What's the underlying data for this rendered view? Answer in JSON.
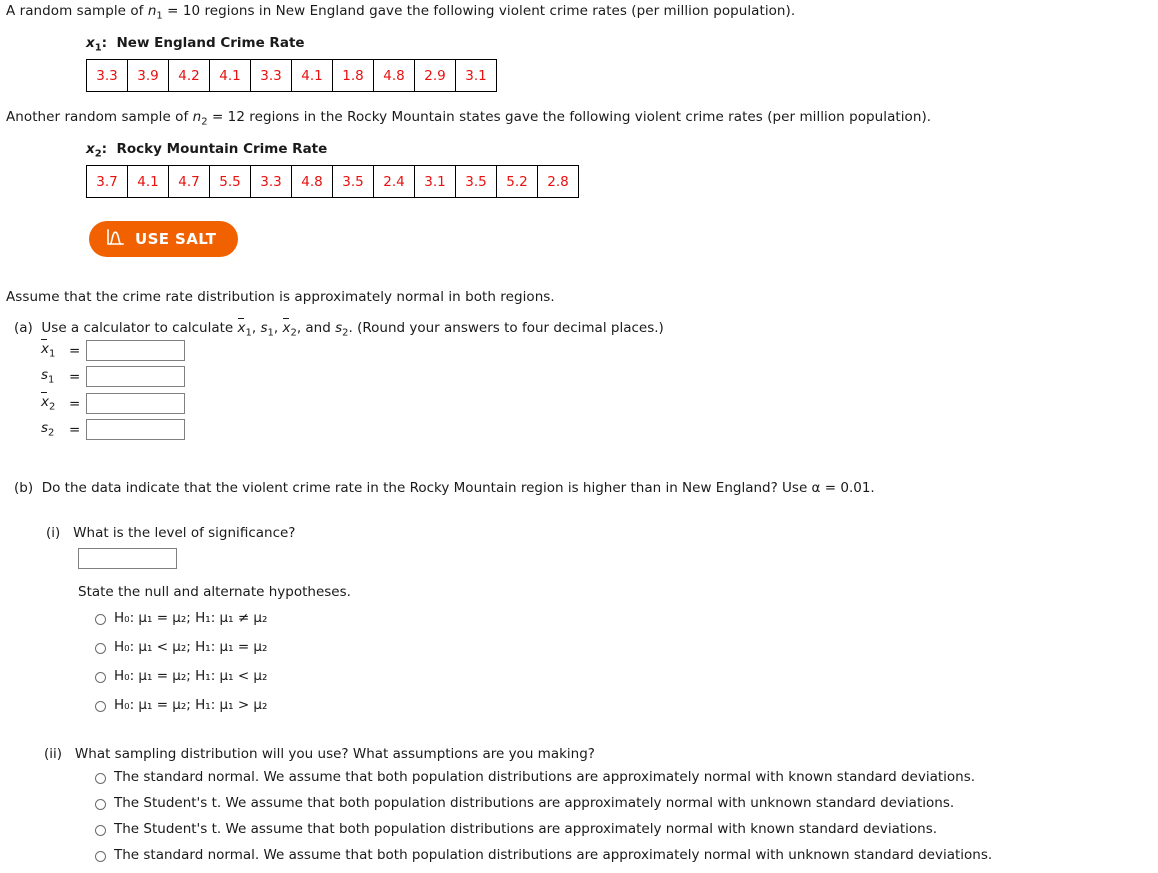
{
  "intro": {
    "line1_pre": "A random sample of ",
    "line1_var": "n",
    "line1_sub": "1",
    "line1_post": " = 10 regions in New England gave the following violent crime rates (per million population).",
    "line2_pre": "Another random sample of ",
    "line2_var": "n",
    "line2_sub": "2",
    "line2_post": " = 12 regions in the Rocky Mountain states gave the following violent crime rates (per million population).",
    "assume": "Assume that the crime rate distribution is approximately normal in both regions."
  },
  "samples": [
    {
      "var_symbol": "x",
      "var_sub": "1",
      "title": "New England Crime Rate",
      "values": [
        "3.3",
        "3.9",
        "4.2",
        "4.1",
        "3.3",
        "4.1",
        "1.8",
        "4.8",
        "2.9",
        "3.1"
      ]
    },
    {
      "var_symbol": "x",
      "var_sub": "2",
      "title": "Rocky Mountain Crime Rate",
      "values": [
        "3.7",
        "4.1",
        "4.7",
        "5.5",
        "3.3",
        "4.8",
        "3.5",
        "2.4",
        "3.1",
        "3.5",
        "5.2",
        "2.8"
      ]
    }
  ],
  "salt_button": {
    "label": "USE SALT",
    "icon": "distribution-curve-icon",
    "background_color": "#f26100",
    "text_color": "#ffffff"
  },
  "part_a": {
    "marker": "(a)",
    "prompt_pre": "Use a calculator to calculate ",
    "prompt_post": ". (Round your answers to four decimal places.)",
    "symbols": [
      "x̄₁",
      "s₁",
      "x̄₂",
      "s₂"
    ],
    "fields": [
      {
        "symbol_base": "x",
        "symbol_sub": "1",
        "overline": true,
        "value": "",
        "placeholder": ""
      },
      {
        "symbol_base": "s",
        "symbol_sub": "1",
        "overline": false,
        "value": "",
        "placeholder": ""
      },
      {
        "symbol_base": "x",
        "symbol_sub": "2",
        "overline": true,
        "value": "",
        "placeholder": ""
      },
      {
        "symbol_base": "s",
        "symbol_sub": "2",
        "overline": false,
        "value": "",
        "placeholder": ""
      }
    ],
    "equals": "="
  },
  "part_b": {
    "marker": "(b)",
    "question": "Do the data indicate that the violent crime rate in the Rocky Mountain region is higher than in New England? Use α = 0.01.",
    "alpha_value": "0.01",
    "sub_i": {
      "marker": "(i)",
      "question": "What is the level of significance?",
      "input_value": "",
      "input_placeholder": "",
      "hypotheses_prompt": "State the null and alternate hypotheses.",
      "options": [
        "H₀: μ₁ = μ₂; H₁: μ₁ ≠ μ₂",
        "H₀: μ₁ < μ₂; H₁: μ₁ = μ₂",
        "H₀: μ₁ = μ₂; H₁: μ₁ < μ₂",
        "H₀: μ₁ = μ₂; H₁: μ₁ > μ₂"
      ],
      "selected": null
    },
    "sub_ii": {
      "marker": "(ii)",
      "question": "What sampling distribution will you use? What assumptions are you making?",
      "options": [
        "The standard normal. We assume that both population distributions are approximately normal with known standard deviations.",
        "The Student's t. We assume that both population distributions are approximately normal with unknown standard deviations.",
        "The Student's t. We assume that both population distributions are approximately normal with known standard deviations.",
        "The standard normal. We assume that both population distributions are approximately normal with unknown standard deviations."
      ],
      "selected": null
    }
  },
  "colors": {
    "data_value": "#e8110f",
    "table_border": "#000000",
    "text": "#1a1a1a",
    "input_border": "#808080",
    "salt_orange": "#f26100"
  }
}
